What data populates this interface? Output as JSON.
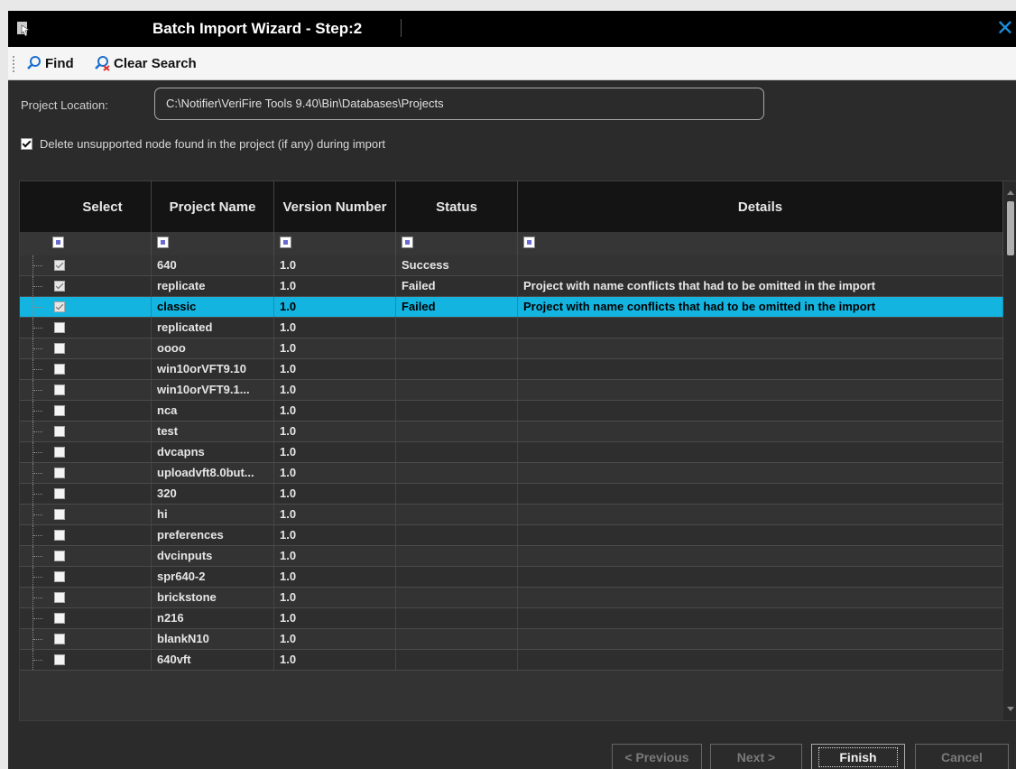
{
  "window": {
    "title": "Batch Import Wizard - Step:2"
  },
  "toolbar": {
    "find_label": "Find",
    "clear_label": "Clear Search"
  },
  "location": {
    "label": "Project Location:",
    "value": "C:\\Notifier\\VeriFire Tools 9.40\\Bin\\Databases\\Projects"
  },
  "delete_option": {
    "label": "Delete unsupported node found in the project (if any) during import",
    "checked": true
  },
  "grid": {
    "columns": [
      "Select",
      "Project Name",
      "Version Number",
      "Status",
      "Details"
    ],
    "rows": [
      {
        "checked": true,
        "name": "640",
        "version": "1.0",
        "status": "Success",
        "details": ""
      },
      {
        "checked": true,
        "name": "replicate",
        "version": "1.0",
        "status": "Failed",
        "details": "Project with name conflicts that had to be omitted in the import"
      },
      {
        "checked": true,
        "name": "classic",
        "version": "1.0",
        "status": "Failed",
        "details": "Project with name conflicts that had to be omitted in the import",
        "selected": true
      },
      {
        "checked": false,
        "name": "replicated",
        "version": "1.0",
        "status": "",
        "details": ""
      },
      {
        "checked": false,
        "name": "oooo",
        "version": "1.0",
        "status": "",
        "details": ""
      },
      {
        "checked": false,
        "name": "win10orVFT9.10",
        "version": "1.0",
        "status": "",
        "details": ""
      },
      {
        "checked": false,
        "name": "win10orVFT9.1...",
        "version": "1.0",
        "status": "",
        "details": ""
      },
      {
        "checked": false,
        "name": "nca",
        "version": "1.0",
        "status": "",
        "details": ""
      },
      {
        "checked": false,
        "name": "test",
        "version": "1.0",
        "status": "",
        "details": ""
      },
      {
        "checked": false,
        "name": "dvcapns",
        "version": "1.0",
        "status": "",
        "details": ""
      },
      {
        "checked": false,
        "name": "uploadvft8.0but...",
        "version": "1.0",
        "status": "",
        "details": ""
      },
      {
        "checked": false,
        "name": "320",
        "version": "1.0",
        "status": "",
        "details": ""
      },
      {
        "checked": false,
        "name": "hi",
        "version": "1.0",
        "status": "",
        "details": ""
      },
      {
        "checked": false,
        "name": "preferences",
        "version": "1.0",
        "status": "",
        "details": ""
      },
      {
        "checked": false,
        "name": "dvcinputs",
        "version": "1.0",
        "status": "",
        "details": ""
      },
      {
        "checked": false,
        "name": "spr640-2",
        "version": "1.0",
        "status": "",
        "details": ""
      },
      {
        "checked": false,
        "name": "brickstone",
        "version": "1.0",
        "status": "",
        "details": ""
      },
      {
        "checked": false,
        "name": "n216",
        "version": "1.0",
        "status": "",
        "details": ""
      },
      {
        "checked": false,
        "name": "blankN10",
        "version": "1.0",
        "status": "",
        "details": ""
      },
      {
        "checked": false,
        "name": "640vft",
        "version": "1.0",
        "status": "",
        "details": ""
      }
    ]
  },
  "footer": {
    "previous": "< Previous",
    "next": "Next >",
    "finish": "Finish",
    "cancel": "Cancel"
  },
  "colors": {
    "selection": "#14b4e0",
    "close_accent": "#1a8fe0",
    "background": "#2b2b2b"
  }
}
